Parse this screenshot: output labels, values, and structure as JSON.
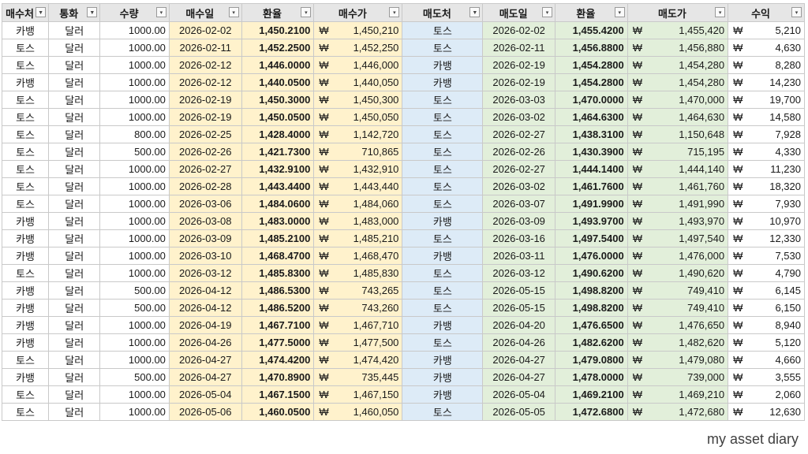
{
  "headers": [
    "매수처",
    "통화",
    "수량",
    "매수일",
    "환율",
    "매수가",
    "매도처",
    "매도일",
    "환율",
    "매도가",
    "수익"
  ],
  "filter_active": [
    true,
    true,
    false,
    false,
    false,
    false,
    true,
    false,
    false,
    false,
    false
  ],
  "currency_symbol": "₩",
  "rows": [
    [
      "카뱅",
      "달러",
      "1000.00",
      "2026-02-02",
      "1,450.2100",
      "1,450,210",
      "토스",
      "2026-02-02",
      "1,455.4200",
      "1,455,420",
      "5,210"
    ],
    [
      "토스",
      "달러",
      "1000.00",
      "2026-02-11",
      "1,452.2500",
      "1,452,250",
      "토스",
      "2026-02-11",
      "1,456.8800",
      "1,456,880",
      "4,630"
    ],
    [
      "토스",
      "달러",
      "1000.00",
      "2026-02-12",
      "1,446.0000",
      "1,446,000",
      "카뱅",
      "2026-02-19",
      "1,454.2800",
      "1,454,280",
      "8,280"
    ],
    [
      "카뱅",
      "달러",
      "1000.00",
      "2026-02-12",
      "1,440.0500",
      "1,440,050",
      "카뱅",
      "2026-02-19",
      "1,454.2800",
      "1,454,280",
      "14,230"
    ],
    [
      "토스",
      "달러",
      "1000.00",
      "2026-02-19",
      "1,450.3000",
      "1,450,300",
      "토스",
      "2026-03-03",
      "1,470.0000",
      "1,470,000",
      "19,700"
    ],
    [
      "토스",
      "달러",
      "1000.00",
      "2026-02-19",
      "1,450.0500",
      "1,450,050",
      "토스",
      "2026-03-02",
      "1,464.6300",
      "1,464,630",
      "14,580"
    ],
    [
      "토스",
      "달러",
      "800.00",
      "2026-02-25",
      "1,428.4000",
      "1,142,720",
      "토스",
      "2026-02-27",
      "1,438.3100",
      "1,150,648",
      "7,928"
    ],
    [
      "토스",
      "달러",
      "500.00",
      "2026-02-26",
      "1,421.7300",
      "710,865",
      "토스",
      "2026-02-26",
      "1,430.3900",
      "715,195",
      "4,330"
    ],
    [
      "토스",
      "달러",
      "1000.00",
      "2026-02-27",
      "1,432.9100",
      "1,432,910",
      "토스",
      "2026-02-27",
      "1,444.1400",
      "1,444,140",
      "11,230"
    ],
    [
      "토스",
      "달러",
      "1000.00",
      "2026-02-28",
      "1,443.4400",
      "1,443,440",
      "토스",
      "2026-03-02",
      "1,461.7600",
      "1,461,760",
      "18,320"
    ],
    [
      "토스",
      "달러",
      "1000.00",
      "2026-03-06",
      "1,484.0600",
      "1,484,060",
      "토스",
      "2026-03-07",
      "1,491.9900",
      "1,491,990",
      "7,930"
    ],
    [
      "카뱅",
      "달러",
      "1000.00",
      "2026-03-08",
      "1,483.0000",
      "1,483,000",
      "카뱅",
      "2026-03-09",
      "1,493.9700",
      "1,493,970",
      "10,970"
    ],
    [
      "카뱅",
      "달러",
      "1000.00",
      "2026-03-09",
      "1,485.2100",
      "1,485,210",
      "토스",
      "2026-03-16",
      "1,497.5400",
      "1,497,540",
      "12,330"
    ],
    [
      "카뱅",
      "달러",
      "1000.00",
      "2026-03-10",
      "1,468.4700",
      "1,468,470",
      "카뱅",
      "2026-03-11",
      "1,476.0000",
      "1,476,000",
      "7,530"
    ],
    [
      "토스",
      "달러",
      "1000.00",
      "2026-03-12",
      "1,485.8300",
      "1,485,830",
      "토스",
      "2026-03-12",
      "1,490.6200",
      "1,490,620",
      "4,790"
    ],
    [
      "카뱅",
      "달러",
      "500.00",
      "2026-04-12",
      "1,486.5300",
      "743,265",
      "토스",
      "2026-05-15",
      "1,498.8200",
      "749,410",
      "6,145"
    ],
    [
      "카뱅",
      "달러",
      "500.00",
      "2026-04-12",
      "1,486.5200",
      "743,260",
      "토스",
      "2026-05-15",
      "1,498.8200",
      "749,410",
      "6,150"
    ],
    [
      "카뱅",
      "달러",
      "1000.00",
      "2026-04-19",
      "1,467.7100",
      "1,467,710",
      "카뱅",
      "2026-04-20",
      "1,476.6500",
      "1,476,650",
      "8,940"
    ],
    [
      "카뱅",
      "달러",
      "1000.00",
      "2026-04-26",
      "1,477.5000",
      "1,477,500",
      "토스",
      "2026-04-26",
      "1,482.6200",
      "1,482,620",
      "5,120"
    ],
    [
      "토스",
      "달러",
      "1000.00",
      "2026-04-27",
      "1,474.4200",
      "1,474,420",
      "카뱅",
      "2026-04-27",
      "1,479.0800",
      "1,479,080",
      "4,660"
    ],
    [
      "카뱅",
      "달러",
      "500.00",
      "2026-04-27",
      "1,470.8900",
      "735,445",
      "카뱅",
      "2026-04-27",
      "1,478.0000",
      "739,000",
      "3,555"
    ],
    [
      "토스",
      "달러",
      "1000.00",
      "2026-05-04",
      "1,467.1500",
      "1,467,150",
      "카뱅",
      "2026-05-04",
      "1,469.2100",
      "1,469,210",
      "2,060"
    ],
    [
      "토스",
      "달러",
      "1000.00",
      "2026-05-06",
      "1,460.0500",
      "1,460,050",
      "토스",
      "2026-05-05",
      "1,472.6800",
      "1,472,680",
      "12,630"
    ]
  ],
  "footer_text": "my asset diary"
}
